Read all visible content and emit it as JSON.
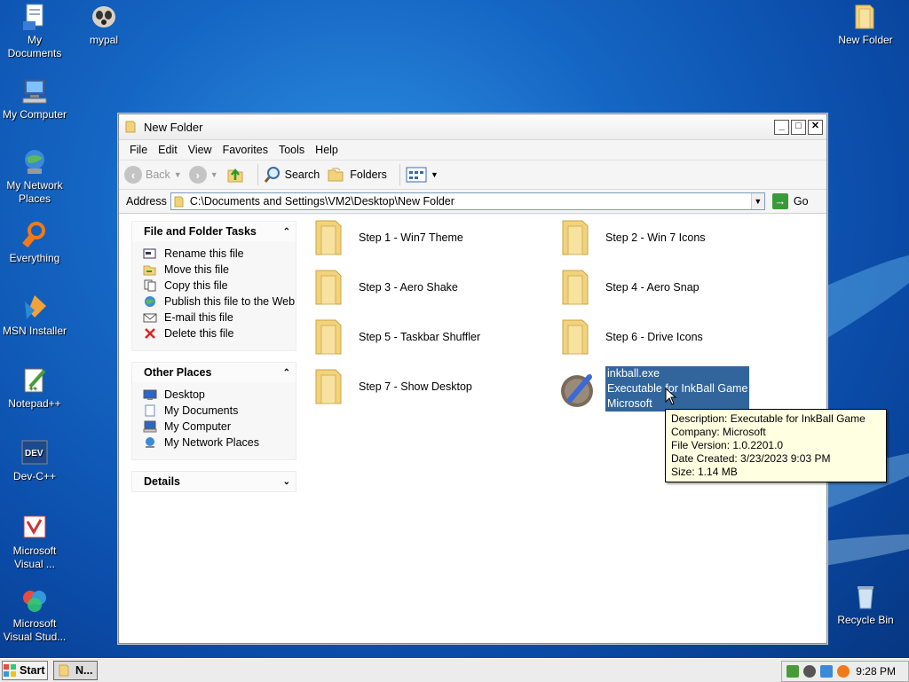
{
  "desktop": {
    "icons_left": [
      {
        "label": "My Documents",
        "icon": "my-documents-icon"
      },
      {
        "label": "My Computer",
        "icon": "my-computer-icon"
      },
      {
        "label": "My Network Places",
        "icon": "network-places-icon"
      },
      {
        "label": "Everything",
        "icon": "everything-icon"
      },
      {
        "label": "MSN Installer",
        "icon": "msn-icon"
      },
      {
        "label": "Notepad++",
        "icon": "notepad-plus-icon"
      },
      {
        "label": "Dev-C++",
        "icon": "devcpp-icon"
      },
      {
        "label": "Microsoft Visual ...",
        "icon": "visual-studio-icon"
      },
      {
        "label": "Microsoft Visual Stud...",
        "icon": "visual-studio-icon"
      }
    ],
    "mypal": {
      "label": "mypal",
      "icon": "mypal-icon"
    },
    "new_folder": {
      "label": "New Folder",
      "icon": "folder-icon"
    },
    "recycle_bin": {
      "label": "Recycle Bin",
      "icon": "recycle-bin-icon"
    }
  },
  "window": {
    "title": "New Folder",
    "menu": [
      "File",
      "Edit",
      "View",
      "Favorites",
      "Tools",
      "Help"
    ],
    "toolbar": {
      "back": "Back",
      "search": "Search",
      "folders": "Folders"
    },
    "address": {
      "label": "Address",
      "value": "C:\\Documents and Settings\\VM2\\Desktop\\New Folder",
      "go": "Go"
    },
    "tasks": {
      "title": "File and Folder Tasks",
      "items": [
        "Rename this file",
        "Move this file",
        "Copy this file",
        "Publish this file to the Web",
        "E-mail this file",
        "Delete this file"
      ]
    },
    "other_places": {
      "title": "Other Places",
      "items": [
        "Desktop",
        "My Documents",
        "My Computer",
        "My Network Places"
      ]
    },
    "details": {
      "title": "Details"
    },
    "files": [
      {
        "name": "Step 1 - Win7 Theme"
      },
      {
        "name": "Step 2 - Win 7 Icons"
      },
      {
        "name": "Step 3 - Aero Shake"
      },
      {
        "name": "Step 4 - Aero Snap"
      },
      {
        "name": "Step 5 - Taskbar Shuffler"
      },
      {
        "name": "Step 6 - Drive Icons"
      },
      {
        "name": "Step 7 - Show Desktop"
      }
    ],
    "selected_file": {
      "name": "inkball.exe",
      "description": "Executable for InkBall Game",
      "company": "Microsoft"
    },
    "tooltip": {
      "line1": "Description: Executable for InkBall Game",
      "line2": "Company: Microsoft",
      "line3": "File Version: 1.0.2201.0",
      "line4": "Date Created: 3/23/2023 9:03 PM",
      "line5": "Size: 1.14 MB"
    }
  },
  "taskbar": {
    "start": "Start",
    "task": "N...",
    "clock": "9:28 PM"
  },
  "colors": {
    "selection": "#31659c",
    "tooltip_bg": "#ffffe1",
    "folder": "#f2d37a"
  }
}
